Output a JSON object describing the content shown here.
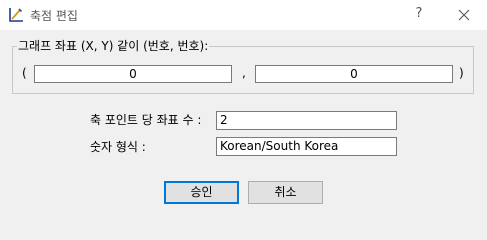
{
  "window": {
    "title": "축점 편집",
    "help_glyph": "?",
    "icon": "axis-edit-icon"
  },
  "group": {
    "legend": "그래프 좌표 (X, Y) 같이 (번호, 번호):",
    "open_paren": "(",
    "separator": ",",
    "close_paren": ")",
    "x_value": "0",
    "y_value": "0"
  },
  "form": {
    "points_label": "축 포인트 당 좌표 수 :",
    "points_value": "2",
    "format_label": "숫자 형식 :",
    "format_value": "Korean/South Korea"
  },
  "buttons": {
    "ok": "승인",
    "cancel": "취소"
  }
}
